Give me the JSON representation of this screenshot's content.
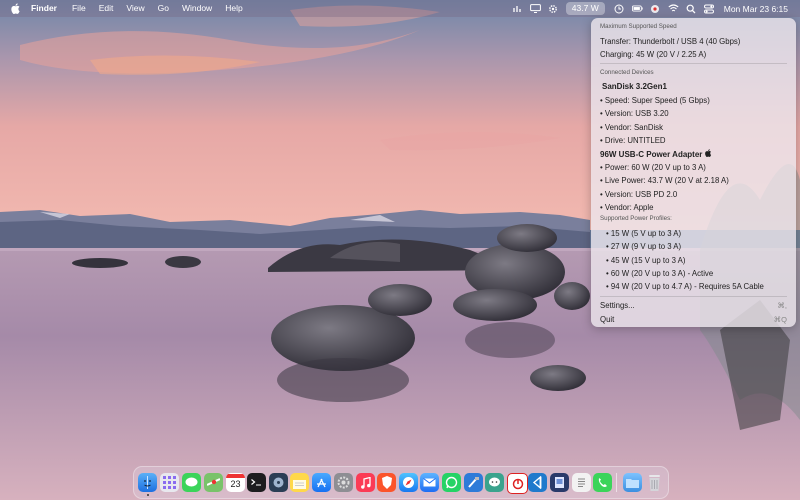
{
  "menubar": {
    "app_name": "Finder",
    "items": [
      "File",
      "Edit",
      "View",
      "Go",
      "Window",
      "Help"
    ],
    "power_readout": "43.7 W",
    "clock": "Mon Mar 23  6:15"
  },
  "panel": {
    "max_speed_header": "Maximum Supported Speed",
    "transfer": "Transfer: Thunderbolt / USB 4 (40 Gbps)",
    "charging": "Charging: 45 W (20 V / 2.25 A)",
    "connected_header": "Connected Devices",
    "device1": {
      "name": "SanDisk 3.2Gen1",
      "speed": "• Speed: Super Speed (5 Gbps)",
      "version": "• Version: USB 3.20",
      "vendor": "• Vendor: SanDisk",
      "drive": "• Drive: UNTITLED"
    },
    "device2": {
      "name": "96W USB-C Power Adapter ",
      "power": "• Power: 60 W (20 V up to 3 A)",
      "live_power": "• Live Power: 43.7 W (20 V at 2.18 A)",
      "version": "• Version: USB PD 2.0",
      "vendor": "• Vendor: Apple",
      "profiles_header": "Supported Power Profiles:",
      "profiles": [
        "• 15 W (5 V up to 3 A)",
        "• 27 W (9 V up to 3 A)",
        "• 45 W (15 V up to 3 A)",
        "• 60 W (20 V up to 3 A) - Active",
        "• 94 W (20 V up to 4.7 A) - Requires 5A Cable"
      ]
    },
    "settings_label": "Settings...",
    "settings_shortcut": "⌘,",
    "quit_label": "Quit",
    "quit_shortcut": "⌘Q"
  },
  "dock": {
    "calendar_day": "23"
  }
}
